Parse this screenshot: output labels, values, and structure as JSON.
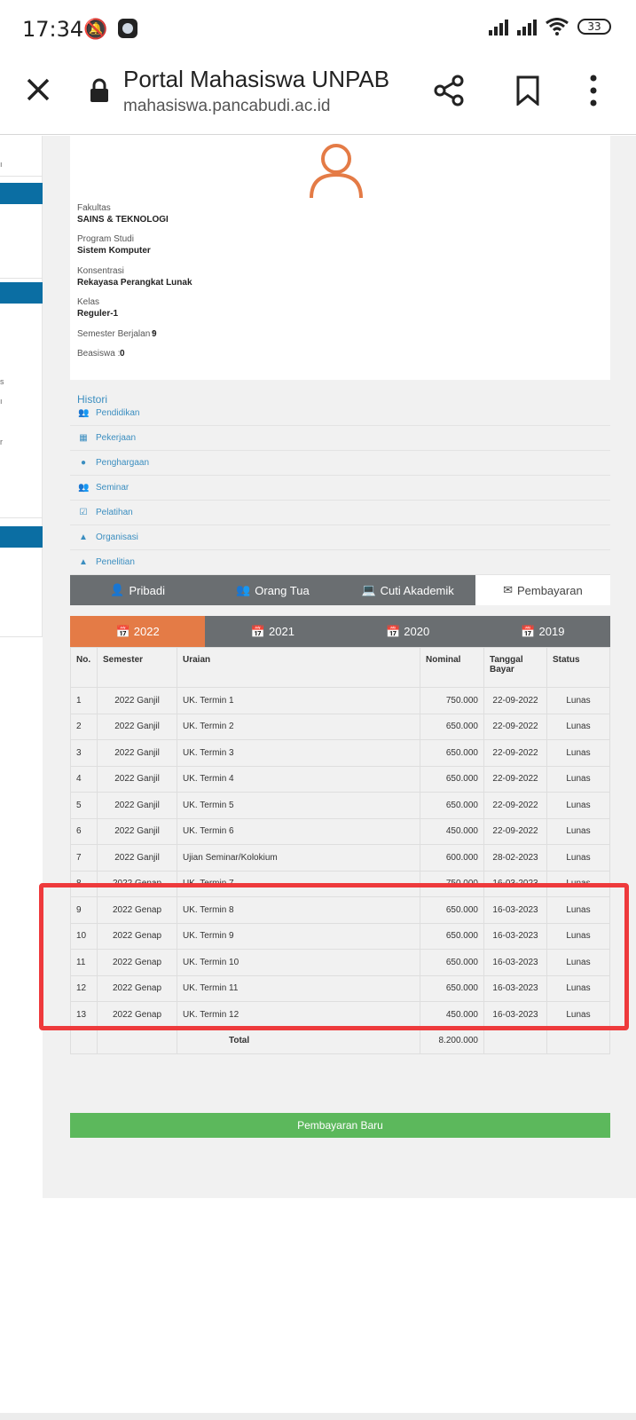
{
  "status_bar": {
    "time": "17:34",
    "battery": "33"
  },
  "browser": {
    "title": "Portal Mahasiswa UNPAB",
    "url": "mahasiswa.pancabudi.ac.id"
  },
  "profile": {
    "fakultas_label": "Fakultas",
    "fakultas": "SAINS & TEKNOLOGI",
    "prodi_label": "Program Studi",
    "prodi": "Sistem Komputer",
    "konsentrasi_label": "Konsentrasi",
    "konsentrasi": "Rekayasa Perangkat Lunak",
    "kelas_label": "Kelas",
    "kelas": "Reguler-1",
    "semester_label": "Semester Berjalan :",
    "semester": "9",
    "beasiswa_label": "Beasiswa :",
    "beasiswa": "0"
  },
  "histori": {
    "title": "Histori",
    "items": [
      {
        "label": "Pendidikan",
        "icon": "users-icon"
      },
      {
        "label": "Pekerjaan",
        "icon": "building-icon"
      },
      {
        "label": "Penghargaan",
        "icon": "user-icon"
      },
      {
        "label": "Seminar",
        "icon": "users-icon"
      },
      {
        "label": "Pelatihan",
        "icon": "checkbox-icon"
      },
      {
        "label": "Organisasi",
        "icon": "warning-icon"
      },
      {
        "label": "Penelitian",
        "icon": "warning-icon"
      }
    ]
  },
  "tabs": [
    "Pribadi",
    "Orang Tua",
    "Cuti Akademik",
    "Pembayaran"
  ],
  "years": [
    "2022",
    "2021",
    "2020",
    "2019"
  ],
  "table": {
    "headers": [
      "No.",
      "Semester",
      "Uraian",
      "Nominal",
      "Tanggal Bayar",
      "Status"
    ],
    "rows": [
      [
        "1",
        "2022 Ganjil",
        "UK. Termin 1",
        "750.000",
        "22-09-2022",
        "Lunas"
      ],
      [
        "2",
        "2022 Ganjil",
        "UK. Termin 2",
        "650.000",
        "22-09-2022",
        "Lunas"
      ],
      [
        "3",
        "2022 Ganjil",
        "UK. Termin 3",
        "650.000",
        "22-09-2022",
        "Lunas"
      ],
      [
        "4",
        "2022 Ganjil",
        "UK. Termin 4",
        "650.000",
        "22-09-2022",
        "Lunas"
      ],
      [
        "5",
        "2022 Ganjil",
        "UK. Termin 5",
        "650.000",
        "22-09-2022",
        "Lunas"
      ],
      [
        "6",
        "2022 Ganjil",
        "UK. Termin 6",
        "450.000",
        "22-09-2022",
        "Lunas"
      ],
      [
        "7",
        "2022 Ganjil",
        "Ujian Seminar/Kolokium",
        "600.000",
        "28-02-2023",
        "Lunas"
      ],
      [
        "8",
        "2022 Genap",
        "UK. Termin 7",
        "750.000",
        "16-03-2023",
        "Lunas"
      ],
      [
        "9",
        "2022 Genap",
        "UK. Termin 8",
        "650.000",
        "16-03-2023",
        "Lunas"
      ],
      [
        "10",
        "2022 Genap",
        "UK. Termin 9",
        "650.000",
        "16-03-2023",
        "Lunas"
      ],
      [
        "11",
        "2022 Genap",
        "UK. Termin 10",
        "650.000",
        "16-03-2023",
        "Lunas"
      ],
      [
        "12",
        "2022 Genap",
        "UK. Termin 11",
        "650.000",
        "16-03-2023",
        "Lunas"
      ],
      [
        "13",
        "2022 Genap",
        "UK. Termin 12",
        "450.000",
        "16-03-2023",
        "Lunas"
      ]
    ],
    "total_label": "Total",
    "total": "8.200.000"
  },
  "pay_button": "Pembayaran Baru",
  "colors": {
    "accent_orange": "#e47b46",
    "tab_gray": "#6a6e71",
    "button_green": "#5cb85c",
    "highlight_red": "#ee3a3c",
    "link_blue": "#3b8ec0",
    "side_blue": "#0b6ea3"
  }
}
